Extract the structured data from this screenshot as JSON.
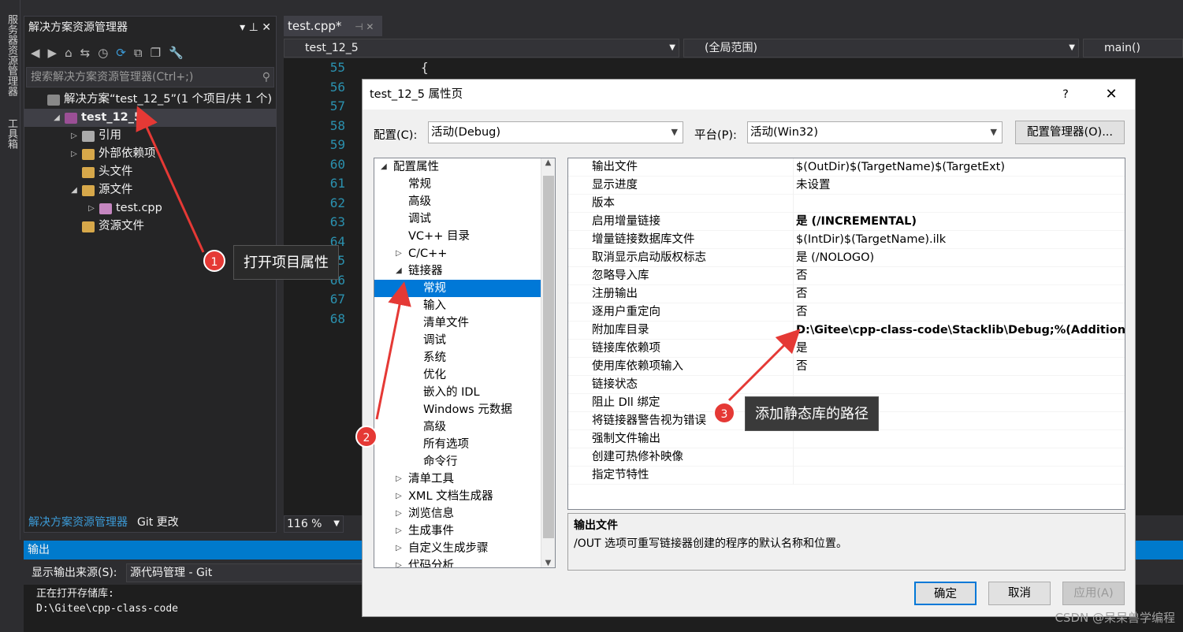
{
  "side_strip": {
    "label1": "服务器资源管理器",
    "label2": "工具箱"
  },
  "solution_explorer": {
    "title": "解决方案资源管理器",
    "title_icons": "▾ ⊥ ✕",
    "search_placeholder": "搜索解决方案资源管理器(Ctrl+;)",
    "tree": [
      {
        "label": "解决方案“test_12_5”(1 个项目/共 1 个)",
        "indent": 0,
        "twisty": "",
        "color": "#888888",
        "bold": false
      },
      {
        "label": "test_12_5",
        "indent": 1,
        "twisty": "◢",
        "color": "#9b4f96",
        "bold": true,
        "selected": true
      },
      {
        "label": "引用",
        "indent": 2,
        "twisty": "▷",
        "color": "#aaaaaa",
        "bold": false
      },
      {
        "label": "外部依赖项",
        "indent": 2,
        "twisty": "▷",
        "color": "#d7a84a",
        "bold": false
      },
      {
        "label": "头文件",
        "indent": 2,
        "twisty": "",
        "color": "#d7a84a",
        "bold": false
      },
      {
        "label": "源文件",
        "indent": 2,
        "twisty": "◢",
        "color": "#d7a84a",
        "bold": false
      },
      {
        "label": "test.cpp",
        "indent": 3,
        "twisty": "▷",
        "color": "#c586c0",
        "bold": false
      },
      {
        "label": "资源文件",
        "indent": 2,
        "twisty": "",
        "color": "#d7a84a",
        "bold": false
      }
    ],
    "tabs": [
      "解决方案资源管理器",
      "Git 更改"
    ]
  },
  "editor": {
    "tab_label": "test.cpp*",
    "tab_pin": "⊣ ✕",
    "nav_project": "test_12_5",
    "nav_scope": "(全局范围)",
    "nav_member": "main()",
    "line_numbers": [
      "55",
      "56",
      "57",
      "58",
      "59",
      "60",
      "61",
      "62",
      "63",
      "64",
      "65",
      "66",
      "67",
      "68"
    ],
    "code_line": "{",
    "zoom": "116 %"
  },
  "output": {
    "title": "输出",
    "source_label": "显示输出来源(S):",
    "source_value": "源代码管理 - Git",
    "lines": [
      "正在打开存储库:",
      "D:\\Gitee\\cpp-class-code"
    ]
  },
  "dialog": {
    "title": "test_12_5 属性页",
    "help": "?",
    "close": "✕",
    "config_label": "配置(C):",
    "config_value": "活动(Debug)",
    "platform_label": "平台(P):",
    "platform_value": "活动(Win32)",
    "config_manager": "配置管理器(O)...",
    "left_tree": [
      {
        "label": "配置属性",
        "level": 0,
        "twisty": "◢"
      },
      {
        "label": "常规",
        "level": 1,
        "twisty": ""
      },
      {
        "label": "高级",
        "level": 1,
        "twisty": ""
      },
      {
        "label": "调试",
        "level": 1,
        "twisty": ""
      },
      {
        "label": "VC++ 目录",
        "level": 1,
        "twisty": ""
      },
      {
        "label": "C/C++",
        "level": 1,
        "twisty": "▷"
      },
      {
        "label": "链接器",
        "level": 1,
        "twisty": "◢"
      },
      {
        "label": "常规",
        "level": 2,
        "twisty": "",
        "selected": true
      },
      {
        "label": "输入",
        "level": 2,
        "twisty": ""
      },
      {
        "label": "清单文件",
        "level": 2,
        "twisty": ""
      },
      {
        "label": "调试",
        "level": 2,
        "twisty": ""
      },
      {
        "label": "系统",
        "level": 2,
        "twisty": ""
      },
      {
        "label": "优化",
        "level": 2,
        "twisty": ""
      },
      {
        "label": "嵌入的 IDL",
        "level": 2,
        "twisty": ""
      },
      {
        "label": "Windows 元数据",
        "level": 2,
        "twisty": ""
      },
      {
        "label": "高级",
        "level": 2,
        "twisty": ""
      },
      {
        "label": "所有选项",
        "level": 2,
        "twisty": ""
      },
      {
        "label": "命令行",
        "level": 2,
        "twisty": ""
      },
      {
        "label": "清单工具",
        "level": 1,
        "twisty": "▷"
      },
      {
        "label": "XML 文档生成器",
        "level": 1,
        "twisty": "▷"
      },
      {
        "label": "浏览信息",
        "level": 1,
        "twisty": "▷"
      },
      {
        "label": "生成事件",
        "level": 1,
        "twisty": "▷"
      },
      {
        "label": "自定义生成步骤",
        "level": 1,
        "twisty": "▷"
      },
      {
        "label": "代码分析",
        "level": 1,
        "twisty": "▷"
      }
    ],
    "props": [
      {
        "name": "输出文件",
        "value": "$(OutDir)$(TargetName)$(TargetExt)",
        "bold": false
      },
      {
        "name": "显示进度",
        "value": "未设置",
        "bold": false
      },
      {
        "name": "版本",
        "value": "",
        "bold": false
      },
      {
        "name": "启用增量链接",
        "value": "是 (/INCREMENTAL)",
        "bold": true
      },
      {
        "name": "增量链接数据库文件",
        "value": "$(IntDir)$(TargetName).ilk",
        "bold": false
      },
      {
        "name": "取消显示启动版权标志",
        "value": "是 (/NOLOGO)",
        "bold": false
      },
      {
        "name": "忽略导入库",
        "value": "否",
        "bold": false
      },
      {
        "name": "注册输出",
        "value": "否",
        "bold": false
      },
      {
        "name": "逐用户重定向",
        "value": "否",
        "bold": false
      },
      {
        "name": "附加库目录",
        "value": "D:\\Gitee\\cpp-class-code\\Stacklib\\Debug;%(AdditionalLi",
        "bold": true
      },
      {
        "name": "链接库依赖项",
        "value": "是",
        "bold": false
      },
      {
        "name": "使用库依赖项输入",
        "value": "否",
        "bold": false
      },
      {
        "name": "链接状态",
        "value": "",
        "bold": false
      },
      {
        "name": "阻止 Dll 绑定",
        "value": "",
        "bold": false
      },
      {
        "name": "将链接器警告视为错误",
        "value": "",
        "bold": false
      },
      {
        "name": "强制文件输出",
        "value": "",
        "bold": false
      },
      {
        "name": "创建可热修补映像",
        "value": "",
        "bold": false
      },
      {
        "name": "指定节特性",
        "value": "",
        "bold": false
      }
    ],
    "desc_title": "输出文件",
    "desc_text": "/OUT 选项可重写链接器创建的程序的默认名称和位置。",
    "ok": "确定",
    "cancel": "取消",
    "apply": "应用(A)"
  },
  "annotations": [
    {
      "num": "1",
      "text": "打开项目属性"
    },
    {
      "num": "2",
      "text": ""
    },
    {
      "num": "3",
      "text": "添加静态库的路径"
    }
  ],
  "colors": {
    "accent": "#007acc",
    "annotation_red": "#e53935",
    "selection": "#0078d7"
  },
  "watermark": "CSDN @呆呆兽学编程"
}
